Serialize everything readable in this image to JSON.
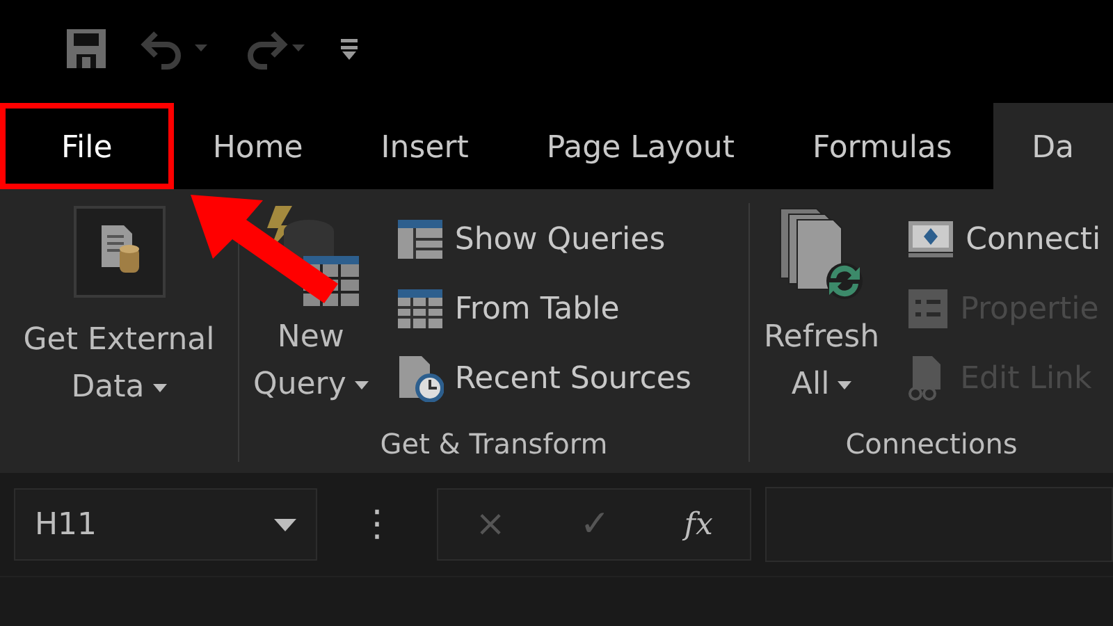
{
  "tabs": [
    {
      "label": "File",
      "selected": false,
      "highlighted": true
    },
    {
      "label": "Home",
      "selected": false,
      "highlighted": false
    },
    {
      "label": "Insert",
      "selected": false,
      "highlighted": false
    },
    {
      "label": "Page Layout",
      "selected": false,
      "highlighted": false
    },
    {
      "label": "Formulas",
      "selected": false,
      "highlighted": false
    },
    {
      "label": "Da",
      "selected": true,
      "highlighted": false
    }
  ],
  "ribbon": {
    "groups": [
      {
        "big": {
          "kind": "external",
          "lines": [
            "Get External",
            "Data"
          ]
        }
      },
      {
        "label": "Get & Transform",
        "big": {
          "kind": "query",
          "lines": [
            "New",
            "Query"
          ]
        },
        "small": [
          {
            "kind": "queries",
            "label": "Show Queries",
            "disabled": false
          },
          {
            "kind": "table",
            "label": "From Table",
            "disabled": false
          },
          {
            "kind": "recent",
            "label": "Recent Sources",
            "disabled": false
          }
        ]
      },
      {
        "label": "Connections",
        "big": {
          "kind": "refresh",
          "lines": [
            "Refresh",
            "All"
          ]
        },
        "small": [
          {
            "kind": "connections",
            "label": "Connecti",
            "disabled": false
          },
          {
            "kind": "properties",
            "label": "Propertie",
            "disabled": true
          },
          {
            "kind": "links",
            "label": "Edit Link",
            "disabled": true
          }
        ]
      }
    ]
  },
  "formula_bar": {
    "name_box": "H11",
    "more": "⋮",
    "cancel": "×",
    "enter": "✓",
    "function": "fx"
  }
}
